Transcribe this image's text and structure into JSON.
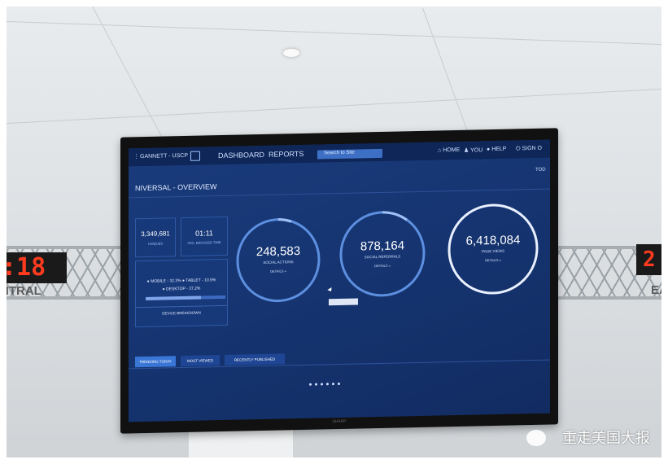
{
  "scene": {
    "left_clock": {
      "time": ":18",
      "label": "NTRAL"
    },
    "right_clock": {
      "time": "2",
      "label": "EA"
    },
    "tv_brand": "SHARP",
    "watermark": "重走美国大报"
  },
  "dashboard": {
    "header": {
      "site": "GANNETT - USCP",
      "nav_dashboard": "DASHBOARD",
      "nav_reports": "REPORTS",
      "search_placeholder": "Search to Site",
      "home": "HOME",
      "you": "YOU",
      "help": "HELP",
      "sign_out": "SIGN O",
      "today": "TOD"
    },
    "title": "NIVERSAL - OVERVIEW",
    "kpis": {
      "uniques_value": "3,349,681",
      "uniques_label": "UNIQUES",
      "engaged_value": "01:11",
      "engaged_label": "AVG. ENGAGED TIME"
    },
    "devices": {
      "line1": "● MOBILE - 32.3%  ● TABLET - 10.5%",
      "line2": "● DESKTOP - 37.2%",
      "mobile_pct": 32.3,
      "tablet_pct": 10.5,
      "desktop_pct": 37.2,
      "label": "DEVICE BREAKDOWN"
    },
    "rings": [
      {
        "value": "248,583",
        "label": "SOCIAL ACTIONS",
        "details": "DETAILS »"
      },
      {
        "value": "878,164",
        "label": "SOCIAL REFERRALS",
        "details": "DETAILS »"
      },
      {
        "value": "6,418,084",
        "label": "PAGE VIEWS",
        "details": "DETAILS »"
      }
    ],
    "tabs": [
      "TRENDING TODAY",
      "MOST VIEWED",
      "RECENTLY PUBLISHED"
    ],
    "page_dots": 6,
    "colors": {
      "bg": "#153470",
      "accent": "#3a76d6",
      "ring": "#5d8fe0"
    }
  }
}
